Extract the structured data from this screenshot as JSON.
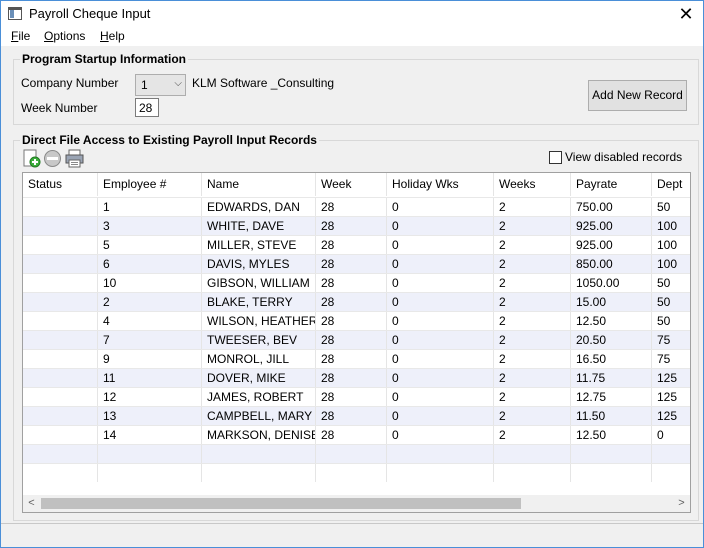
{
  "window": {
    "title": "Payroll Cheque Input",
    "close_glyph": "✕"
  },
  "menu": [
    {
      "label": "File",
      "underline": "F",
      "rest": "ile"
    },
    {
      "label": "Options",
      "underline": "O",
      "rest": "ptions"
    },
    {
      "label": "Help",
      "underline": "H",
      "rest": "elp"
    }
  ],
  "startup": {
    "group_title": "Program Startup Information",
    "company_label": "Company Number",
    "company_value": "1",
    "company_name": "KLM Software _Consulting",
    "week_label": "Week Number",
    "week_value": "28",
    "add_button": "Add New Record"
  },
  "records": {
    "group_title": "Direct File Access to Existing Payroll Input Records",
    "view_disabled_label": "View disabled records",
    "view_disabled_checked": false,
    "columns": [
      "Status",
      "Employee #",
      "Name",
      "Week",
      "Holiday Wks",
      "Weeks",
      "Payrate",
      "Dept"
    ],
    "rows": [
      [
        "",
        "1",
        "EDWARDS, DAN",
        "28",
        "0",
        "2",
        "750.00",
        "50"
      ],
      [
        "",
        "3",
        "WHITE, DAVE",
        "28",
        "0",
        "2",
        "925.00",
        "100"
      ],
      [
        "",
        "5",
        "MILLER, STEVE",
        "28",
        "0",
        "2",
        "925.00",
        "100"
      ],
      [
        "",
        "6",
        "DAVIS, MYLES",
        "28",
        "0",
        "2",
        "850.00",
        "100"
      ],
      [
        "",
        "10",
        "GIBSON, WILLIAM",
        "28",
        "0",
        "2",
        "1050.00",
        "50"
      ],
      [
        "",
        "2",
        "BLAKE, TERRY",
        "28",
        "0",
        "2",
        "15.00",
        "50"
      ],
      [
        "",
        "4",
        "WILSON, HEATHER",
        "28",
        "0",
        "2",
        "12.50",
        "50"
      ],
      [
        "",
        "7",
        "TWEESER, BEV",
        "28",
        "0",
        "2",
        "20.50",
        "75"
      ],
      [
        "",
        "9",
        "MONROL, JILL",
        "28",
        "0",
        "2",
        "16.50",
        "75"
      ],
      [
        "",
        "11",
        "DOVER, MIKE",
        "28",
        "0",
        "2",
        "11.75",
        "125"
      ],
      [
        "",
        "12",
        "JAMES, ROBERT",
        "28",
        "0",
        "2",
        "12.75",
        "125"
      ],
      [
        "",
        "13",
        "CAMPBELL, MARY",
        "28",
        "0",
        "2",
        "11.50",
        "125"
      ],
      [
        "",
        "14",
        "MARKSON, DENISE",
        "28",
        "0",
        "2",
        "12.50",
        "0"
      ],
      [
        "",
        "",
        "",
        "",
        "",
        "",
        "",
        ""
      ],
      [
        "",
        "",
        "",
        "",
        "",
        "",
        "",
        ""
      ]
    ],
    "toolbar_icons": [
      "new-record-icon",
      "disable-record-icon",
      "print-icon"
    ]
  },
  "scroll": {
    "left": "<",
    "right": ">"
  }
}
